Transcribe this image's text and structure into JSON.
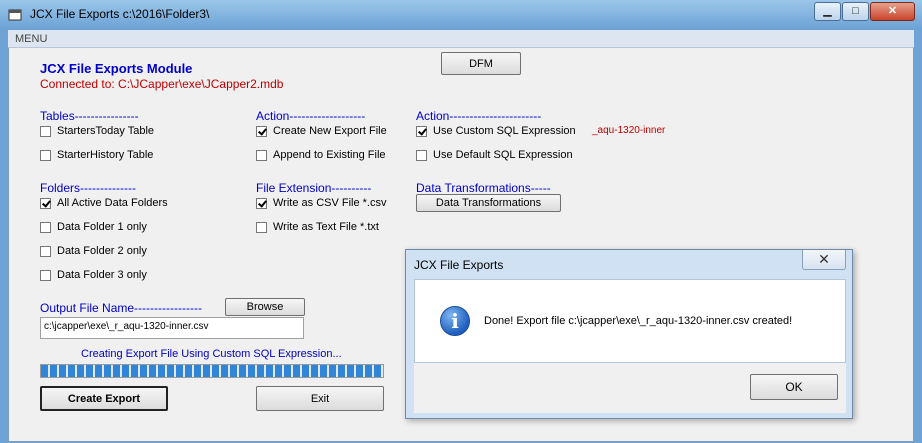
{
  "window": {
    "title": "JCX File Exports c:\\2016\\Folder3\\",
    "minimize_label": "▁",
    "maximize_label": "□",
    "close_label": "✕"
  },
  "menu": {
    "label": "MENU"
  },
  "module": {
    "title": "JCX File Exports Module",
    "connected": "Connected to: C:\\JCapper\\exe\\JCapper2.mdb",
    "dfm_button": "DFM"
  },
  "tables": {
    "heading": "Tables----------------",
    "items": [
      {
        "label": "StartersToday Table",
        "checked": false
      },
      {
        "label": "StarterHistory Table",
        "checked": false
      }
    ]
  },
  "action1": {
    "heading": "Action-------------------",
    "items": [
      {
        "label": "Create New Export File",
        "checked": true
      },
      {
        "label": "Append to Existing File",
        "checked": false
      }
    ]
  },
  "action2": {
    "heading": "Action-----------------------",
    "items": [
      {
        "label": "Use Custom SQL Expression",
        "checked": true
      },
      {
        "label": "Use Default SQL Expression",
        "checked": false
      }
    ],
    "sql_name": "_aqu-1320-inner"
  },
  "folders": {
    "heading": "Folders--------------",
    "items": [
      {
        "label": "All Active Data Folders",
        "checked": true
      },
      {
        "label": "Data Folder 1 only",
        "checked": false
      },
      {
        "label": "Data Folder 2 only",
        "checked": false
      },
      {
        "label": "Data Folder 3 only",
        "checked": false
      }
    ]
  },
  "extension": {
    "heading": "File Extension----------",
    "items": [
      {
        "label": "Write as CSV File  *.csv",
        "checked": true
      },
      {
        "label": "Write as Text File *.txt",
        "checked": false
      }
    ]
  },
  "transforms": {
    "heading": "Data Transformations-----",
    "button": "Data Transformations"
  },
  "output": {
    "heading": "Output File Name-----------------",
    "browse": "Browse",
    "value": "c:\\jcapper\\exe\\_r_aqu-1320-inner.csv",
    "status": "Creating Export File Using Custom SQL Expression...",
    "progress": 1.0
  },
  "buttons": {
    "create": "Create Export",
    "exit": "Exit"
  },
  "dialog": {
    "title": "JCX File Exports",
    "close": "✕",
    "message": "Done! Export file c:\\jcapper\\exe\\_r_aqu-1320-inner.csv created!",
    "ok": "OK"
  }
}
